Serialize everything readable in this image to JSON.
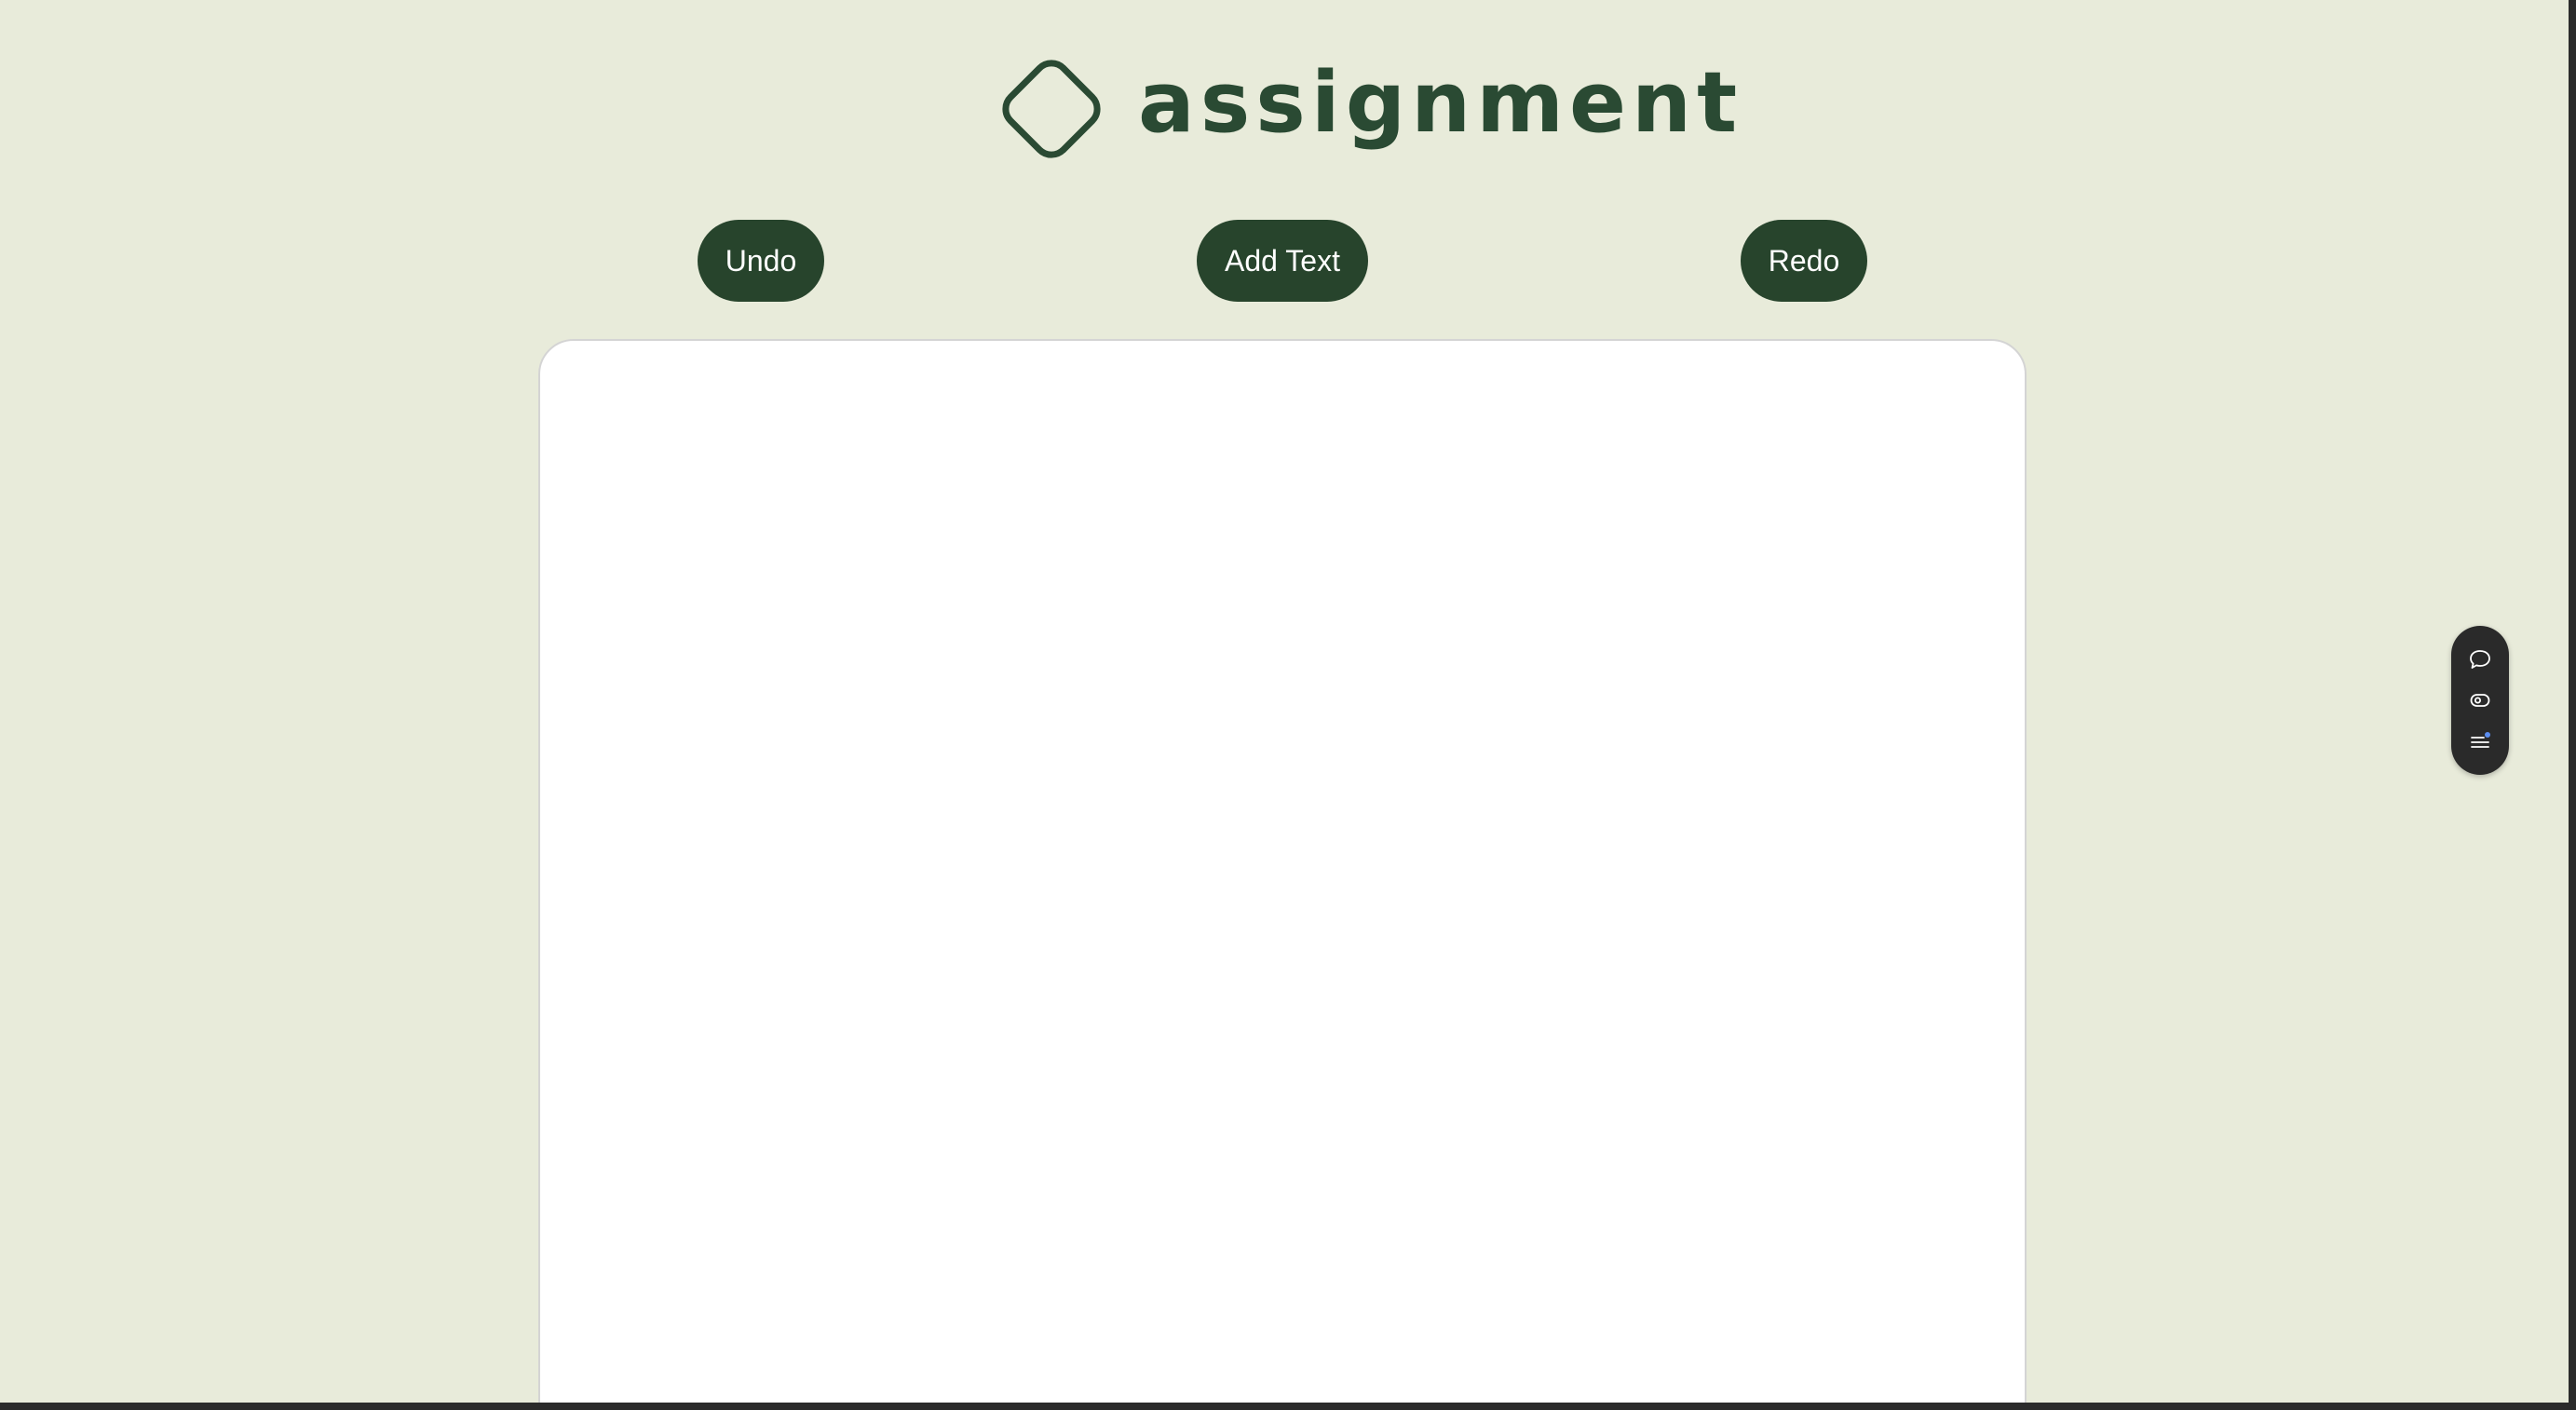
{
  "app": {
    "logo_text": "assignment"
  },
  "toolbar": {
    "undo_label": "Undo",
    "add_text_label": "Add Text",
    "redo_label": "Redo"
  },
  "colors": {
    "background": "#e8ebda",
    "accent": "#27442c",
    "canvas": "#ffffff",
    "widget": "#2a2a2a",
    "notification_dot": "#5b8def"
  },
  "side_widget": {
    "icons": [
      "chat-bubble-icon",
      "eye-icon",
      "list-icon"
    ]
  }
}
